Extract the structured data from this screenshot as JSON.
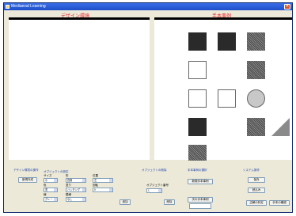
{
  "window": {
    "title": "Mediaeval Learning",
    "close_glyph": "✕"
  },
  "panels": {
    "design_label": "デザイン環境",
    "sample_label": "手本事例"
  },
  "design_group": {
    "title": "デザイン環境の操作",
    "new_button": "新規作成",
    "object_group_title": "オブジェクトの設定",
    "size_label": "サイズ",
    "size_value": "小",
    "color_label": "色",
    "color_value": "黒",
    "shape_label": "形",
    "shape_value": "四角",
    "fill_label": "塗り",
    "fill_value": "ハッチング",
    "pattern_label": "模様",
    "pattern_value": "なし",
    "position_label": "位置",
    "position_value": "左",
    "rotation_label": "回転",
    "rotation_value": "0",
    "line_label": "線",
    "line_value": "グレー",
    "add_button": "追加",
    "number_title": "オブジェクトの削除",
    "number_label": "オブジェクト番号",
    "number_value": "1",
    "delete_button": "削除"
  },
  "sample_group": {
    "title": "手本事例の選択",
    "new_sample_button": "新規手本事例",
    "next_sample_button": "次の手本事例"
  },
  "system_group": {
    "title": "システム操作",
    "save_button": "保存",
    "load_button": "読込み",
    "score_button": "正解の判定",
    "exit_button": "手本の確認"
  },
  "colors": {
    "accent": "#e8232b",
    "title_bar": "#1e4fc9"
  }
}
